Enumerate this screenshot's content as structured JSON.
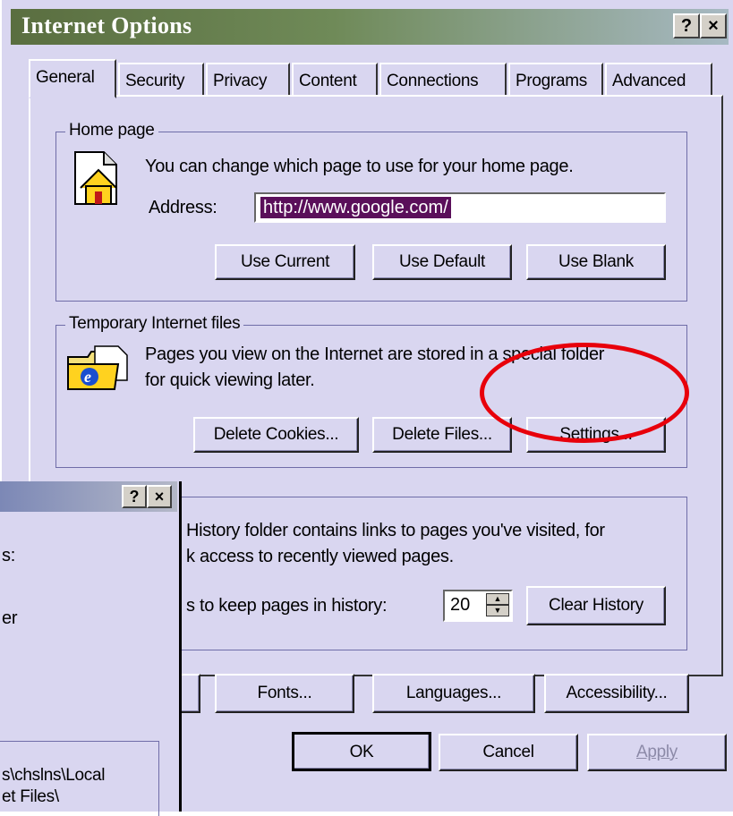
{
  "window": {
    "title": "Internet Options",
    "help_btn": "?",
    "close_btn": "×"
  },
  "tabs": [
    {
      "label": "General"
    },
    {
      "label": "Security"
    },
    {
      "label": "Privacy"
    },
    {
      "label": "Content"
    },
    {
      "label": "Connections"
    },
    {
      "label": "Programs"
    },
    {
      "label": "Advanced"
    }
  ],
  "home_page": {
    "group_title": "Home page",
    "description": "You can change which page to use for your home page.",
    "address_label": "Address:",
    "address_value": "http://www.google.com/",
    "use_current": "Use Current",
    "use_default": "Use Default",
    "use_blank": "Use Blank"
  },
  "temp_files": {
    "group_title": "Temporary Internet files",
    "line1": "Pages you view on the Internet are stored in a special folder",
    "line2": "for quick viewing later.",
    "delete_cookies": "Delete Cookies...",
    "delete_files": "Delete Files...",
    "settings": "Settings..."
  },
  "history": {
    "line1": "History folder contains links to pages you've visited, for",
    "line2": "k access to recently viewed pages.",
    "days_label": "s to keep pages in history:",
    "days_value": "20",
    "clear_history": "Clear History"
  },
  "bottom_buttons": {
    "fonts": "Fonts...",
    "languages": "Languages...",
    "accessibility": "Accessibility..."
  },
  "dialog_buttons": {
    "ok": "OK",
    "cancel": "Cancel",
    "apply": "Apply"
  },
  "overlay": {
    "help_btn": "?",
    "close_btn": "×",
    "text1": "s:",
    "text2": "er",
    "path1": "s\\chslns\\Local",
    "path2": "et Files\\"
  },
  "colors": {
    "annotation_circle": "#e8000b",
    "selection": "#5a0f5a",
    "title_gradient_start": "#5a6e40"
  }
}
